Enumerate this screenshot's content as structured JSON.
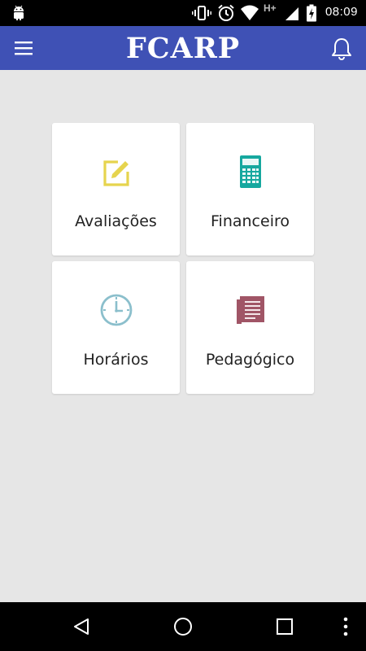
{
  "status_bar": {
    "time": "08:09",
    "network_label": "H+"
  },
  "app_bar": {
    "title": "FCARP",
    "primary_color": "#3f51b5"
  },
  "menu": {
    "cards": [
      {
        "label": "Avaliações",
        "icon": "edit-icon",
        "color": "#e6d44e"
      },
      {
        "label": "Financeiro",
        "icon": "calculator-icon",
        "color": "#16a89f"
      },
      {
        "label": "Horários",
        "icon": "clock-icon",
        "color": "#8bbfcc"
      },
      {
        "label": "Pedagógico",
        "icon": "book-icon",
        "color": "#a05566"
      }
    ]
  }
}
